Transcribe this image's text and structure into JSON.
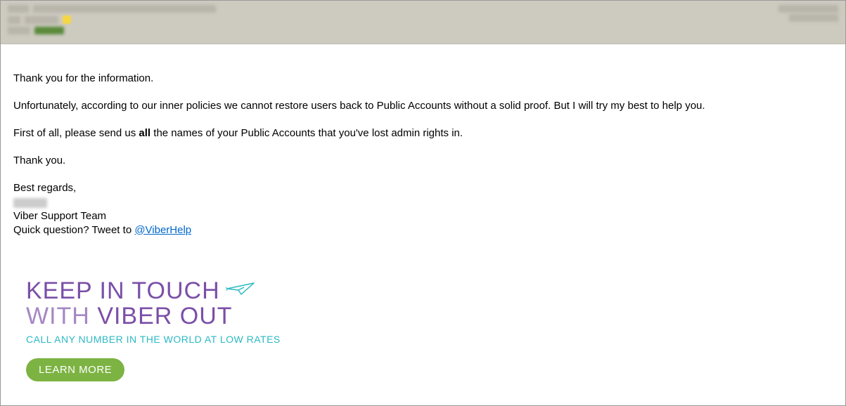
{
  "message": {
    "greeting": "Thank you for the information.",
    "para2": "Unfortunately, according to our inner policies we cannot restore users back to Public Accounts without a solid proof. But I will try my best to help you.",
    "para3_before": "First of all, please send us ",
    "para3_bold": "all",
    "para3_after": " the names of your Public Accounts that you've lost admin rights in.",
    "thanks": "Thank you.",
    "regards": "Best regards,",
    "team": "Viber Support Team",
    "tweet_prefix": "Quick question? Tweet to ",
    "tweet_handle": "@ViberHelp"
  },
  "promo": {
    "line1": "KEEP IN TOUCH",
    "line2a": "WITH ",
    "line2b": "VIBER OUT",
    "sub": "CALL ANY NUMBER IN THE WORLD AT LOW RATES",
    "cta": "LEARN MORE"
  }
}
